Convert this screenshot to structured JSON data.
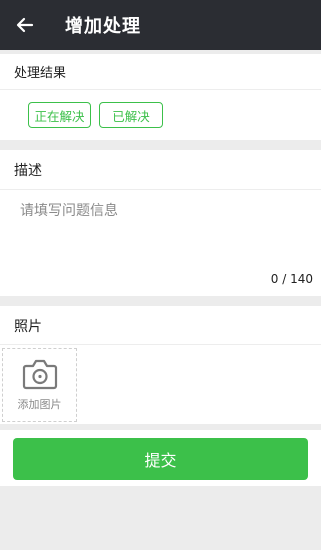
{
  "header": {
    "title": "增加处理",
    "back_icon": "arrow-left-icon",
    "background": "#2b2d33"
  },
  "result": {
    "label": "处理结果",
    "options": [
      {
        "label": "正在解决"
      },
      {
        "label": "已解决"
      }
    ],
    "accent": "#3cc04a"
  },
  "description": {
    "label": "描述",
    "placeholder": "请填写问题信息",
    "value": "",
    "counter": "0 / 140"
  },
  "photos": {
    "label": "照片",
    "add_label": "添加图片",
    "icon": "camera-icon"
  },
  "submit": {
    "label": "提交",
    "color": "#3cc04a"
  }
}
